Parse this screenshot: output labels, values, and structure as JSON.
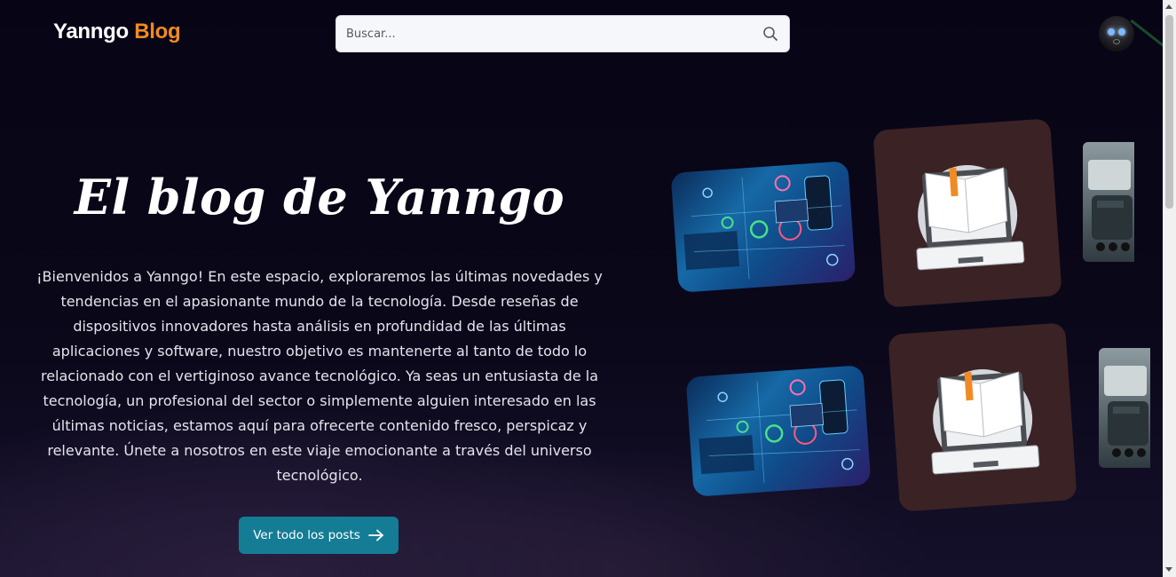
{
  "header": {
    "logo": {
      "part1": "Yanngo",
      "part2": "Blog"
    },
    "search": {
      "placeholder": "Buscar..."
    }
  },
  "hero": {
    "title": "El blog de Yanngo",
    "description": "¡Bienvenidos a Yanngo! En este espacio, exploraremos las últimas novedades y tendencias en el apasionante mundo de la tecnología. Desde reseñas de dispositivos innovadores hasta análisis en profundidad de las últimas aplicaciones y software, nuestro objetivo es mantenerte al tanto de todo lo relacionado con el vertiginoso avance tecnológico. Ya seas un entusiasta de la tecnología, un profesional del sector o simplemente alguien interesado en las últimas noticias, estamos aquí para ofrecerte contenido fresco, perspicaz y relevante. Únete a nosotros en este viaje emocionante a través del universo tecnológico.",
    "cta_label": "Ver todo los posts"
  },
  "gallery": {
    "images": [
      {
        "icon": "technology-network-image"
      },
      {
        "icon": "laptop-book-image"
      },
      {
        "icon": "robot-image"
      },
      {
        "icon": "technology-network-image"
      },
      {
        "icon": "laptop-book-image"
      },
      {
        "icon": "robot-image"
      }
    ]
  },
  "colors": {
    "background": "#090619",
    "logo_accent": "#f08a24",
    "cta_background": "#157c95",
    "book_card": "#3a2225"
  }
}
